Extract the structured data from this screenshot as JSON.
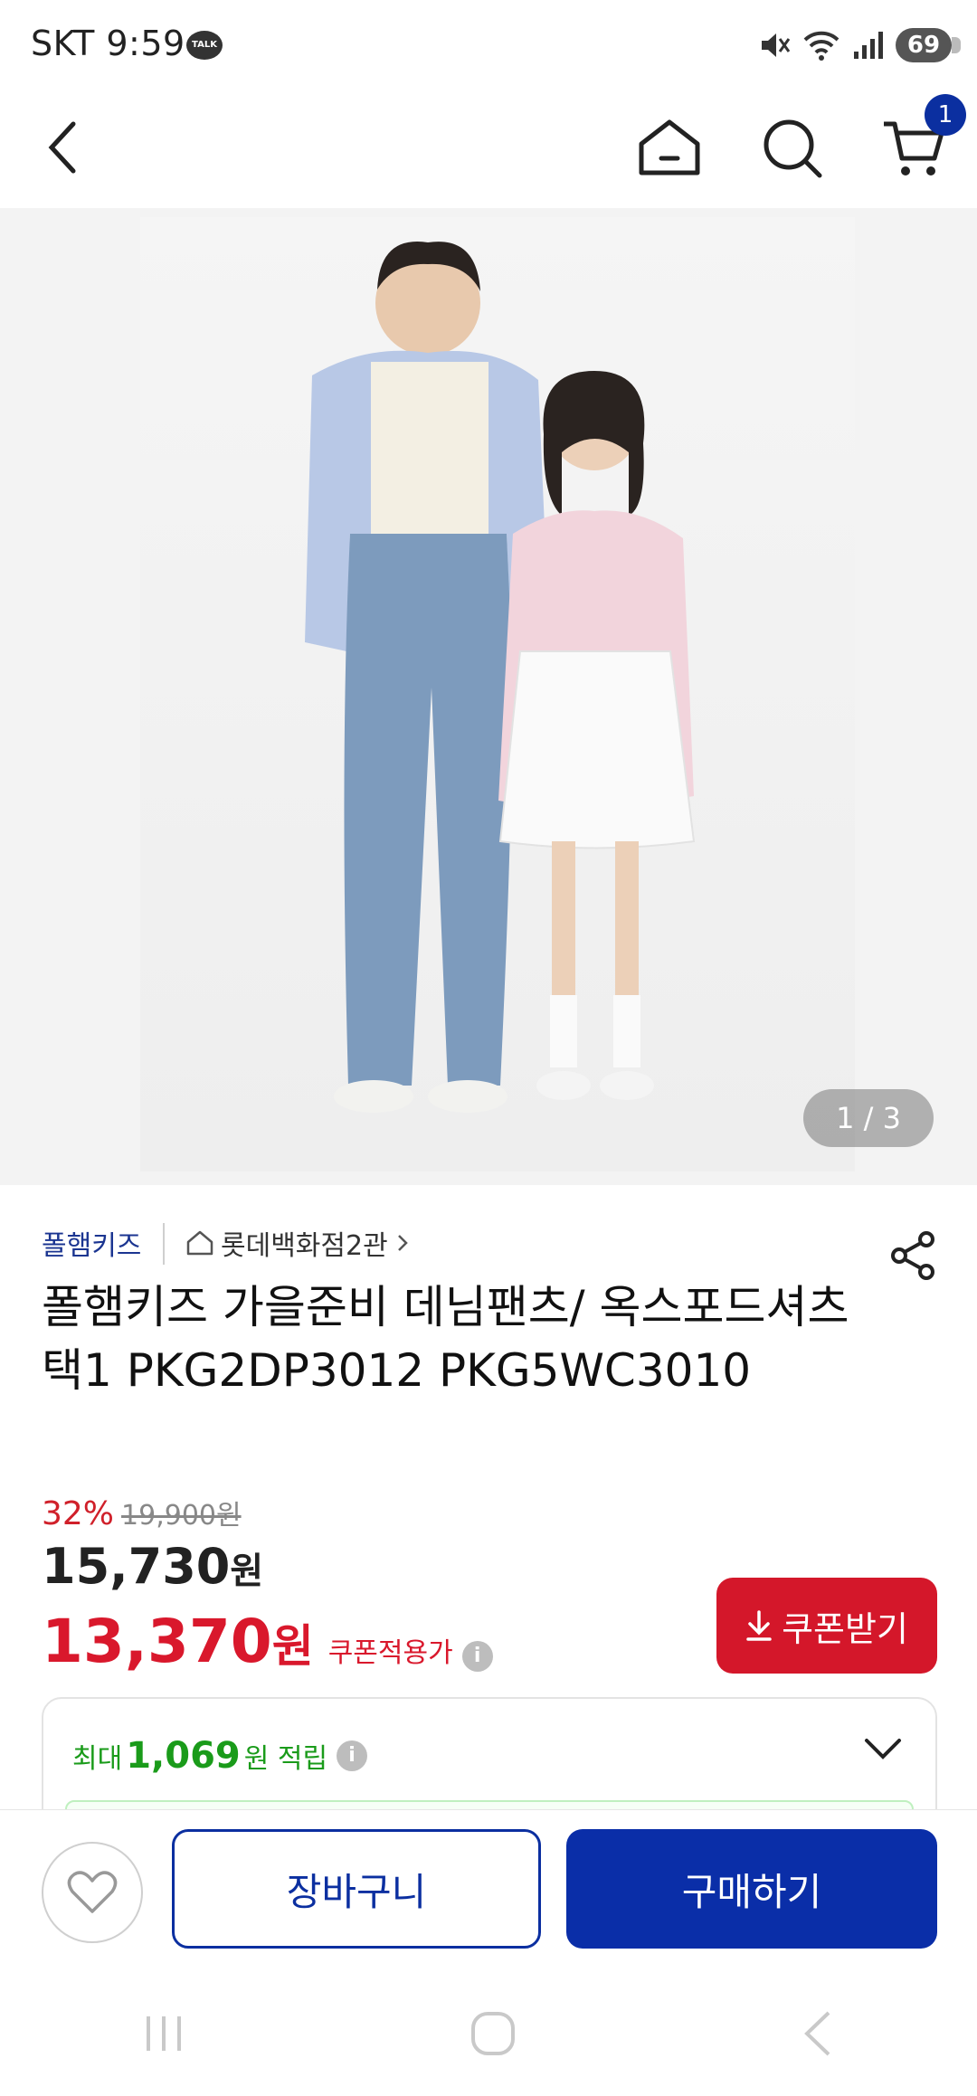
{
  "status_bar": {
    "carrier_time": "SKT 9:59",
    "talk_badge": "TALK",
    "battery": "69"
  },
  "header": {
    "cart_count": "1"
  },
  "gallery": {
    "counter": "1 / 3"
  },
  "product": {
    "brand": "폴햄키즈",
    "store": "롯데백화점2관",
    "title": "폴햄키즈 가을준비 데님팬츠/ 옥스포드셔츠 택1  PKG2DP3012 PKG5WC3010",
    "discount": "32%",
    "original_price": "19,900원",
    "price_value": "15,730",
    "price_unit": "원",
    "coupon_price_value": "13,370",
    "coupon_price_unit": "원",
    "coupon_price_label": "쿠폰적용가",
    "coupon_button": "쿠폰받기",
    "points_prefix": "최대",
    "points_value": "1,069",
    "points_suffix": "원 적립"
  },
  "actions": {
    "cart": "장바구니",
    "buy": "구매하기"
  },
  "colors": {
    "primary_blue": "#0a2ea8",
    "accent_red": "#d4172a",
    "points_green": "#1a9b1a"
  }
}
